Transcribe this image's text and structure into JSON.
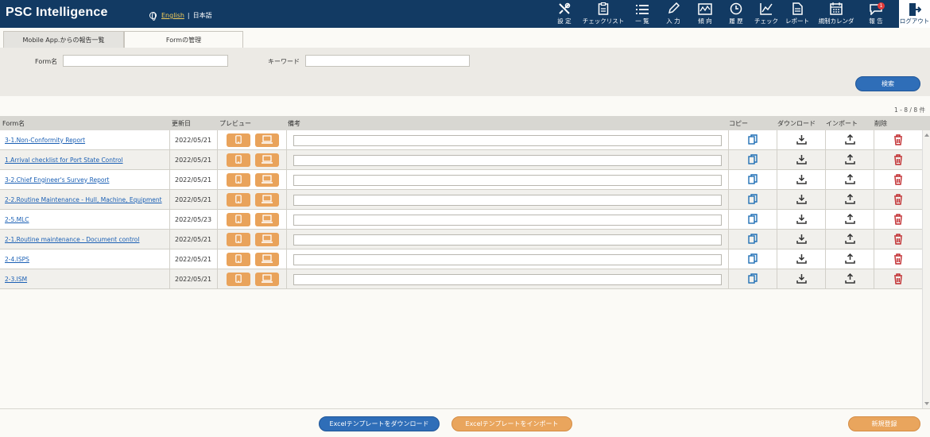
{
  "header": {
    "title": "PSC Intelligence",
    "lang_en": "English",
    "lang_sep": "|",
    "lang_ja": "日本語",
    "nav": [
      {
        "label": "設 定",
        "icon": "tools-icon"
      },
      {
        "label": "チェックリスト",
        "icon": "clipboard-icon"
      },
      {
        "label": "一 覧",
        "icon": "list-icon"
      },
      {
        "label": "入 力",
        "icon": "pencil-icon"
      },
      {
        "label": "傾 向",
        "icon": "map-icon"
      },
      {
        "label": "履 歴",
        "icon": "clock-icon"
      },
      {
        "label": "チェック",
        "icon": "chart-line-icon"
      },
      {
        "label": "レポート",
        "icon": "document-icon"
      },
      {
        "label": "規制カレンダ",
        "icon": "calendar-icon"
      },
      {
        "label": "報 告",
        "icon": "chat-bubble-icon",
        "badge": "1"
      }
    ],
    "logout_label": "ログアウト"
  },
  "tabs": [
    {
      "label": "Mobile App.からの報告一覧",
      "active": false
    },
    {
      "label": "Formの管理",
      "active": true
    }
  ],
  "search": {
    "form_name_label": "Form名",
    "form_name_value": "",
    "keyword_label": "キーワード",
    "keyword_value": "",
    "search_button": "検索"
  },
  "count_text": "1 - 8 / 8 件",
  "table": {
    "headers": {
      "form": "Form名",
      "updated": "更新日",
      "preview": "プレビュー",
      "note": "備考",
      "copy": "コピー",
      "download": "ダウンロード",
      "import": "インポート",
      "delete": "削除"
    },
    "rows": [
      {
        "form": "3-1.Non-Conformity Report",
        "date": "2022/05/21",
        "note": ""
      },
      {
        "form": "1.Arrival checklist for Port State Control",
        "date": "2022/05/21",
        "note": ""
      },
      {
        "form": "3-2.Chief Engineer's Survey Report",
        "date": "2022/05/21",
        "note": ""
      },
      {
        "form": "2-2.Routine Maintenance - Hull, Machine, Equipment",
        "date": "2022/05/21",
        "note": ""
      },
      {
        "form": "2-5.MLC",
        "date": "2022/05/23",
        "note": ""
      },
      {
        "form": "2-1.Routine maintenance - Document control",
        "date": "2022/05/21",
        "note": ""
      },
      {
        "form": "2-4.ISPS",
        "date": "2022/05/21",
        "note": ""
      },
      {
        "form": "2-3.ISM",
        "date": "2022/05/21",
        "note": ""
      }
    ]
  },
  "footer": {
    "download_template": "Excelテンプレートをダウンロード",
    "import_template": "Excelテンプレートをインポート",
    "new_register": "新規登録"
  },
  "colors": {
    "header_bg": "#123a63",
    "accent_blue": "#2f6eb8",
    "accent_orange": "#e9a55d",
    "delete_red": "#c0282b",
    "copy_blue": "#1f6fb5"
  }
}
